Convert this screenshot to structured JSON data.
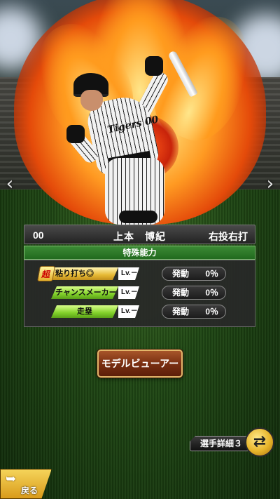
{
  "player": {
    "number": "00",
    "name": "上本　博紀",
    "handedness": "右投右打",
    "jersey_text": "Tigers 00"
  },
  "abilities": {
    "header": "特殊能力",
    "items": [
      {
        "super": "超",
        "label": "粘り打ち◎",
        "level": "Lv.－",
        "activation_label": "発動",
        "activation_value": "0％",
        "color": "gold"
      },
      {
        "super": "",
        "label": "チャンスメーカー",
        "level": "Lv.－",
        "activation_label": "発動",
        "activation_value": "0％",
        "color": "green"
      },
      {
        "super": "",
        "label": "走塁",
        "level": "Lv.－",
        "activation_label": "発動",
        "activation_value": "0％",
        "color": "green"
      }
    ]
  },
  "buttons": {
    "model_viewer": "モデルビューアー",
    "player_detail": "選手詳細３",
    "back": "戻る"
  },
  "icons": {
    "prev": "chevron-left-icon",
    "next": "chevron-right-icon",
    "swap": "swap-icon",
    "back": "back-arrow-icon"
  },
  "colors": {
    "ability_header": "#2f7d2a",
    "gold_label": "#e6b934",
    "green_label": "#82d12a",
    "model_button": "#7a2f12"
  }
}
